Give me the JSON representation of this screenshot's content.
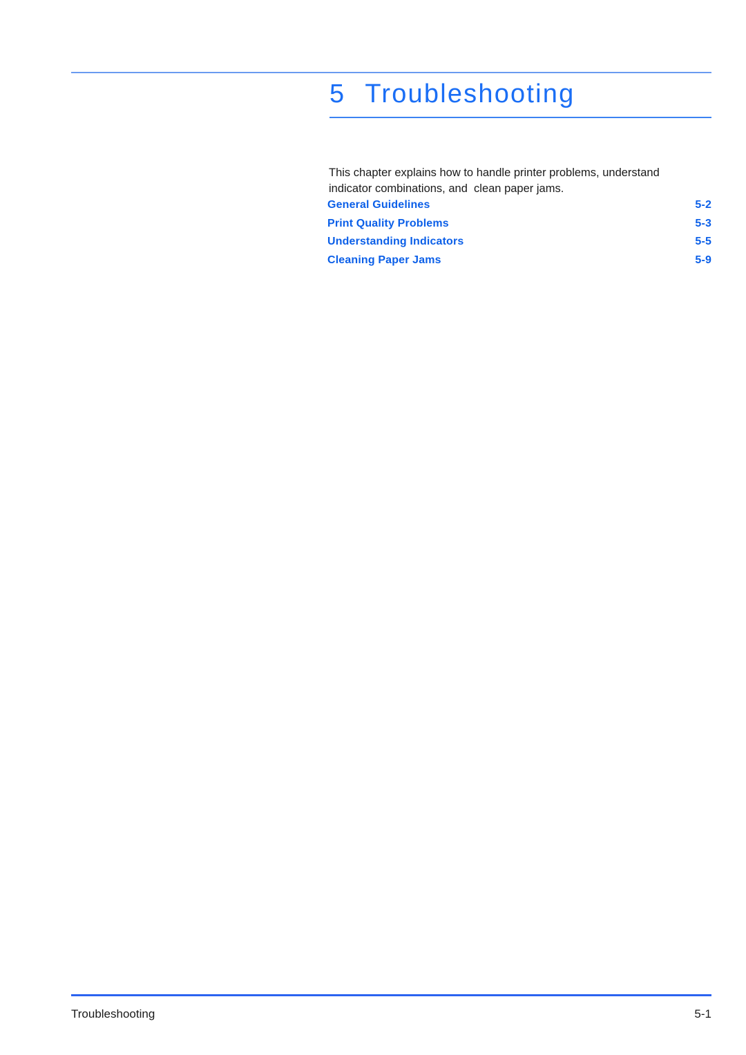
{
  "document": {
    "chapter_number": "5",
    "chapter_title": "Troubleshooting",
    "intro_paragraph": "This chapter explains how to handle printer problems, understand indicator combinations, and  clean paper jams."
  },
  "contents": {
    "entries": [
      {
        "label": "General Guidelines",
        "page": "5-2"
      },
      {
        "label": "Print Quality Problems",
        "page": "5-3"
      },
      {
        "label": "Understanding Indicators",
        "page": "5-5"
      },
      {
        "label": "Cleaning Paper Jams",
        "page": "5-9"
      }
    ]
  },
  "footer": {
    "left_text": "Troubleshooting",
    "page_number": "5-1"
  },
  "colors": {
    "title_blue": "#1a6ef5",
    "toc_blue": "#0b5fe8",
    "rule_light_blue": "#6a9bf0",
    "rule_footer_blue": "#2b63f0",
    "body_text": "#1a1a1a"
  }
}
